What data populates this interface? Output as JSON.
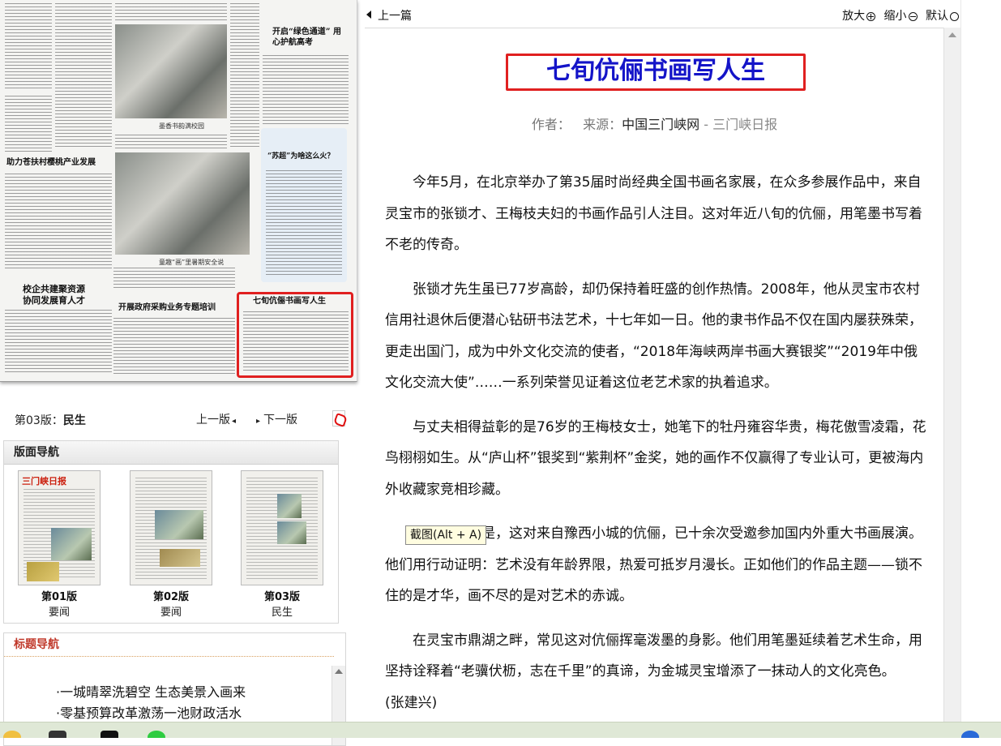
{
  "edition_bar": {
    "edition_prefix": "第03版：",
    "edition_name": "民生",
    "prev_edition": "上一版",
    "next_edition": "下一版"
  },
  "page_nav": {
    "title": "版面导航",
    "pages": [
      {
        "number": "第01版",
        "name": "要闻",
        "masthead": "三门峡日报"
      },
      {
        "number": "第02版",
        "name": "要闻"
      },
      {
        "number": "第03版",
        "name": "民生"
      }
    ]
  },
  "title_nav": {
    "title": "标题导航",
    "items": [
      "·一城晴翠洗碧空 生态美景入画来",
      "·零基预算改革激荡一池财政活水"
    ]
  },
  "toolbar": {
    "prev_article": "上一篇",
    "zoom_in": "放大",
    "zoom_out": "缩小",
    "zoom_default": "默认"
  },
  "article": {
    "title": "七旬伉俪书画写人生",
    "author_label": "作者：",
    "source_label": "来源：",
    "source_site": "中国三门峡网",
    "source_paper": " - 三门峡日报",
    "paragraphs": [
      "今年5月，在北京举办了第35届时尚经典全国书画名家展，在众多参展作品中，来自灵宝市的张锁才、王梅枝夫妇的书画作品引人注目。这对年近八旬的伉俪，用笔墨书写着不老的传奇。",
      "张锁才先生虽已77岁高龄，却仍保持着旺盛的创作热情。2008年，他从灵宝市农村信用社退休后便潜心钻研书法艺术，十七年如一日。他的隶书作品不仅在国内屡获殊荣，更走出国门，成为中外文化交流的使者，“2018年海峡两岸书画大赛银奖”“2019年中俄文化交流大使”……一系列荣誉见证着这位老艺术家的执着追求。",
      "与丈夫相得益彰的是76岁的王梅枝女士，她笔下的牡丹雍容华贵，梅花傲雪凌霜，花鸟栩栩如生。从“庐山杯”银奖到“紫荆杯”金奖，她的画作不仅赢得了专业认可，更被海内外收藏家竞相珍藏。",
      "令人敬佩的是，这对来自豫西小城的伉俪，已十余次受邀参加国内外重大书画展演。他们用行动证明：艺术没有年龄界限，热爱可抵岁月漫长。正如他们的作品主题——锁不住的是才华，画不尽的是对艺术的赤诚。",
      "在灵宝市鼎湖之畔，常见这对伉俪挥毫泼墨的身影。他们用笔墨延续着艺术生命，用坚持诠释着“老骥伏枥，志在千里”的真谛，为金城灵宝增添了一抹动人的文化亮色。　　(张建兴)"
    ]
  },
  "tooltip": "截图(Alt + A)",
  "newspaper_preview": {
    "headlines": [
      "开启“绿色通道” 用心护航高考",
      "助力苍扶村樱桃产业发展",
      "校企共建聚资源 协同发展育人才",
      "开展政府采购业务专题培训",
      "七旬伉俪书画写人生",
      "“苏超”为啥这么火？"
    ],
    "captions": [
      "墨香书韵满校园",
      "童趣“画”里暑期安全说"
    ]
  }
}
